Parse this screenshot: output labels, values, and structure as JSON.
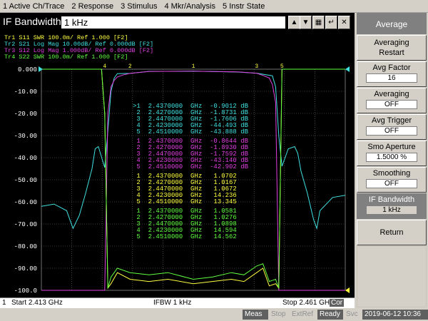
{
  "menu": [
    "1 Active Ch/Trace",
    "2 Response",
    "3 Stimulus",
    "4 Mkr/Analysis",
    "5 Instr State"
  ],
  "entry": {
    "label": "IF Bandwidth",
    "value": "1 kHz"
  },
  "traces": [
    {
      "id": "Tr1",
      "text": "S11  SWR 100.0m/ Ref 1.000  [F2]",
      "color": "#ffff40"
    },
    {
      "id": "Tr2",
      "text": "S21  Log Mag 10.00dB/ Ref 0.000dB [F2]",
      "color": "#40e0e0"
    },
    {
      "id": "Tr3",
      "text": "S12  Log Mag 1.000dB/ Ref 0.000dB [F2]",
      "color": "#e040e0"
    },
    {
      "id": "Tr4",
      "text": "S22  SWR 100.0m/ Ref 1.000  [F2]",
      "color": "#60ff40"
    }
  ],
  "y_labels": [
    "0.000",
    "-10.00",
    "-20.00",
    "-30.00",
    "-40.00",
    "-50.00",
    "-60.00",
    "-70.00",
    "-80.00",
    "-90.00",
    "-100.0"
  ],
  "marker_tables": [
    {
      "color": "#40e0e0",
      "rows": [
        [
          ">1",
          "2.4370000",
          "GHz",
          "-0.9012",
          "dB"
        ],
        [
          "2",
          "2.4270000",
          "GHz",
          "-1.8731",
          "dB"
        ],
        [
          "3",
          "2.4470000",
          "GHz",
          "-1.7606",
          "dB"
        ],
        [
          "4",
          "2.4230000",
          "GHz",
          "-44.493",
          "dB"
        ],
        [
          "5",
          "2.4510000",
          "GHz",
          "-43.888",
          "dB"
        ]
      ]
    },
    {
      "color": "#e040e0",
      "rows": [
        [
          "1",
          "2.4370000",
          "GHz",
          "-0.8644",
          "dB"
        ],
        [
          "2",
          "2.4270000",
          "GHz",
          "-1.8930",
          "dB"
        ],
        [
          "3",
          "2.4470000",
          "GHz",
          "-1.7592",
          "dB"
        ],
        [
          "4",
          "2.4230000",
          "GHz",
          "-43.140",
          "dB"
        ],
        [
          "5",
          "2.4510000",
          "GHz",
          "-42.902",
          "dB"
        ]
      ]
    },
    {
      "color": "#ffff40",
      "rows": [
        [
          "1",
          "2.4370000",
          "GHz",
          "1.0702",
          ""
        ],
        [
          "2",
          "2.4270000",
          "GHz",
          "1.0167",
          ""
        ],
        [
          "3",
          "2.4470000",
          "GHz",
          "1.0672",
          ""
        ],
        [
          "4",
          "2.4230000",
          "GHz",
          "14.236",
          ""
        ],
        [
          "5",
          "2.4510000",
          "GHz",
          "13.345",
          ""
        ]
      ]
    },
    {
      "color": "#60ff40",
      "rows": [
        [
          "1",
          "2.4370000",
          "GHz",
          "1.0581",
          ""
        ],
        [
          "2",
          "2.4270000",
          "GHz",
          "1.0276",
          ""
        ],
        [
          "3",
          "2.4470000",
          "GHz",
          "1.0898",
          ""
        ],
        [
          "4",
          "2.4230000",
          "GHz",
          "14.594",
          ""
        ],
        [
          "5",
          "2.4510000",
          "GHz",
          "14.562",
          ""
        ]
      ]
    }
  ],
  "status": {
    "channel": "1",
    "start": "Start 2.413 GHz",
    "ifbw": "IFBW 1 kHz",
    "stop": "Stop 2.461 GHz",
    "cor": "Cor"
  },
  "bottom": {
    "meas": "Meas",
    "stop": "Stop",
    "extref": "ExtRef",
    "ready": "Ready",
    "svc": "Svc",
    "datetime": "2019-06-12 10:36"
  },
  "softkeys": {
    "title": "Average",
    "restart": "Averaging\nRestart",
    "avg_factor_label": "Avg Factor",
    "avg_factor_value": "16",
    "averaging_label": "Averaging",
    "averaging_value": "OFF",
    "avg_trigger_label": "Avg Trigger",
    "avg_trigger_value": "OFF",
    "smo_aperture_label": "Smo Aperture",
    "smo_aperture_value": "1.5000  %",
    "smoothing_label": "Smoothing",
    "smoothing_value": "OFF",
    "if_bw_label": "IF Bandwidth",
    "if_bw_value": "1 kHz",
    "return": "Return"
  },
  "chart_data": {
    "type": "line",
    "x_unit": "GHz",
    "xlim": [
      2.413,
      2.461
    ],
    "ylim": [
      -100,
      0
    ],
    "grid": true,
    "series": [
      {
        "name": "S21",
        "color": "#40e0e0",
        "x": [
          2.413,
          2.415,
          2.417,
          2.4175,
          2.418,
          2.419,
          2.42,
          2.421,
          2.4215,
          2.422,
          2.423,
          2.4235,
          2.424,
          2.4245,
          2.425,
          2.427,
          2.43,
          2.437,
          2.444,
          2.447,
          2.4495,
          2.45,
          2.4505,
          2.451,
          2.452,
          2.453,
          2.4535,
          2.454,
          2.455,
          2.456,
          2.4565,
          2.457,
          2.459,
          2.461
        ],
        "y": [
          -62,
          -61,
          -64,
          -68,
          -72,
          -66,
          -56,
          -45,
          -36,
          -35,
          -44.5,
          -28,
          -10,
          -4,
          -2,
          -1.9,
          -1.0,
          -0.9,
          -1.3,
          -1.8,
          -3,
          -8,
          -30,
          -43.9,
          -36,
          -35,
          -38,
          -46,
          -56,
          -68,
          -72,
          -64,
          -58,
          -57
        ]
      },
      {
        "name": "S12",
        "color": "#e040e0",
        "x": [
          2.413,
          2.423,
          2.4235,
          2.424,
          2.4245,
          2.425,
          2.426,
          2.427,
          2.43,
          2.437,
          2.444,
          2.447,
          2.448,
          2.449,
          2.4495,
          2.45,
          2.4505,
          2.461
        ],
        "y": [
          -100,
          -100,
          -20,
          -8,
          -5,
          -3.5,
          -2.5,
          -1.9,
          -1.0,
          -0.9,
          -1.2,
          -1.8,
          -2.8,
          -4,
          -7,
          -15,
          -100,
          -100
        ]
      },
      {
        "name": "S11",
        "color": "#ffff40",
        "x": [
          2.413,
          2.4225,
          2.423,
          2.4235,
          2.424,
          2.425,
          2.427,
          2.43,
          2.433,
          2.437,
          2.44,
          2.443,
          2.445,
          2.447,
          2.448,
          2.449,
          2.45,
          2.4505,
          2.451,
          2.461
        ],
        "y": [
          0,
          0,
          -20,
          -99,
          -97,
          -92,
          -95,
          -96,
          -95,
          -97,
          -96,
          -95,
          -96,
          -92,
          -90,
          -98,
          -97,
          -99,
          0,
          0
        ]
      },
      {
        "name": "S22",
        "color": "#60ff40",
        "x": [
          2.413,
          2.4225,
          2.423,
          2.4235,
          2.424,
          2.425,
          2.427,
          2.43,
          2.433,
          2.437,
          2.44,
          2.443,
          2.445,
          2.447,
          2.448,
          2.449,
          2.45,
          2.4505,
          2.451,
          2.461
        ],
        "y": [
          0,
          0,
          -20,
          -99,
          -94,
          -90,
          -92,
          -93,
          -92,
          -95,
          -94,
          -92,
          -93,
          -89,
          -88,
          -96,
          -95,
          -99,
          0,
          0
        ]
      }
    ]
  }
}
